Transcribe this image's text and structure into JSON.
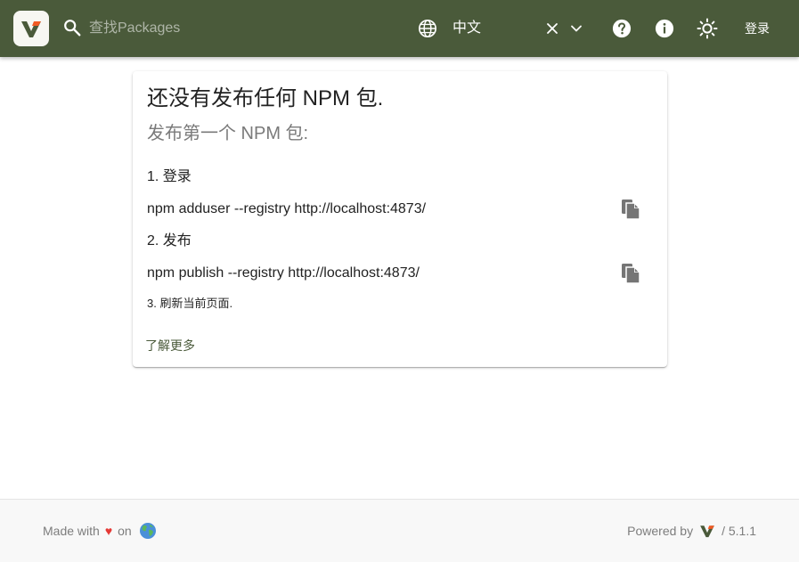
{
  "header": {
    "search": {
      "placeholder": "查找Packages",
      "value": ""
    },
    "language": {
      "selected": "中文"
    },
    "login_label": "登录",
    "colors": {
      "background": "#4a5a3a"
    },
    "icons": [
      "logo",
      "search-icon",
      "globe-icon",
      "close-icon",
      "chevron-down-icon",
      "help-icon",
      "info-icon",
      "sun-icon"
    ]
  },
  "card": {
    "title": "还没有发布任何 NPM 包.",
    "subtitle": "发布第一个 NPM 包:",
    "steps": [
      {
        "label": "1. 登录",
        "command": "npm adduser --registry http://localhost:4873/"
      },
      {
        "label": "2. 发布",
        "command": "npm publish --registry http://localhost:4873/"
      }
    ],
    "step3": "3. 刷新当前页面.",
    "learn_more": "了解更多"
  },
  "footer": {
    "made_with": "Made with",
    "heart": "♥",
    "on": "on",
    "powered_by": "Powered by",
    "version": "/ 5.1.1"
  }
}
